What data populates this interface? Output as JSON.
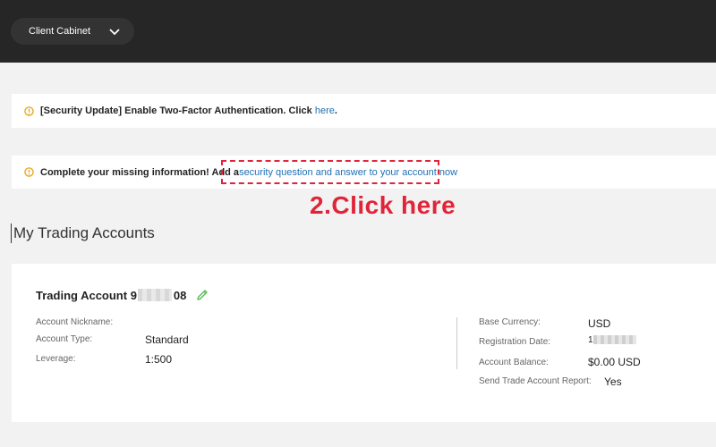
{
  "header": {
    "cabinet_label": "Client Cabinet",
    "cabinet_icon": "chevron-down-icon"
  },
  "notices": [
    {
      "icon": "warning-circle-icon",
      "text": "[Security Update] Enable Two-Factor Authentication. Click ",
      "link": "here",
      "suffix": "."
    },
    {
      "icon": "warning-circle-icon",
      "text": "Complete your missing information! Add a ",
      "link": "security question and answer to your account now"
    }
  ],
  "annotation": {
    "callout_text": "2.Click here",
    "color": "#e0243a"
  },
  "section": {
    "title": "My Trading Accounts"
  },
  "account": {
    "title_prefix": "Trading Account 9",
    "title_suffix": "08",
    "edit_icon": "pencil-icon",
    "left": [
      {
        "label": "Account Nickname:",
        "value": ""
      },
      {
        "label": "Account Type:",
        "value": "Standard"
      },
      {
        "label": "Leverage:",
        "value": "1:500"
      }
    ],
    "right": [
      {
        "label": "Base Currency:",
        "value": "USD"
      },
      {
        "label": "Registration Date:",
        "value": "1"
      },
      {
        "label": "Account Balance:",
        "value": "$0.00 USD"
      },
      {
        "label": "Send Trade Account Report:",
        "value": "Yes"
      }
    ]
  },
  "colors": {
    "topbar": "#262626",
    "link": "#1f6fb2",
    "warning": "#e8a317",
    "edit": "#5cb85c"
  }
}
